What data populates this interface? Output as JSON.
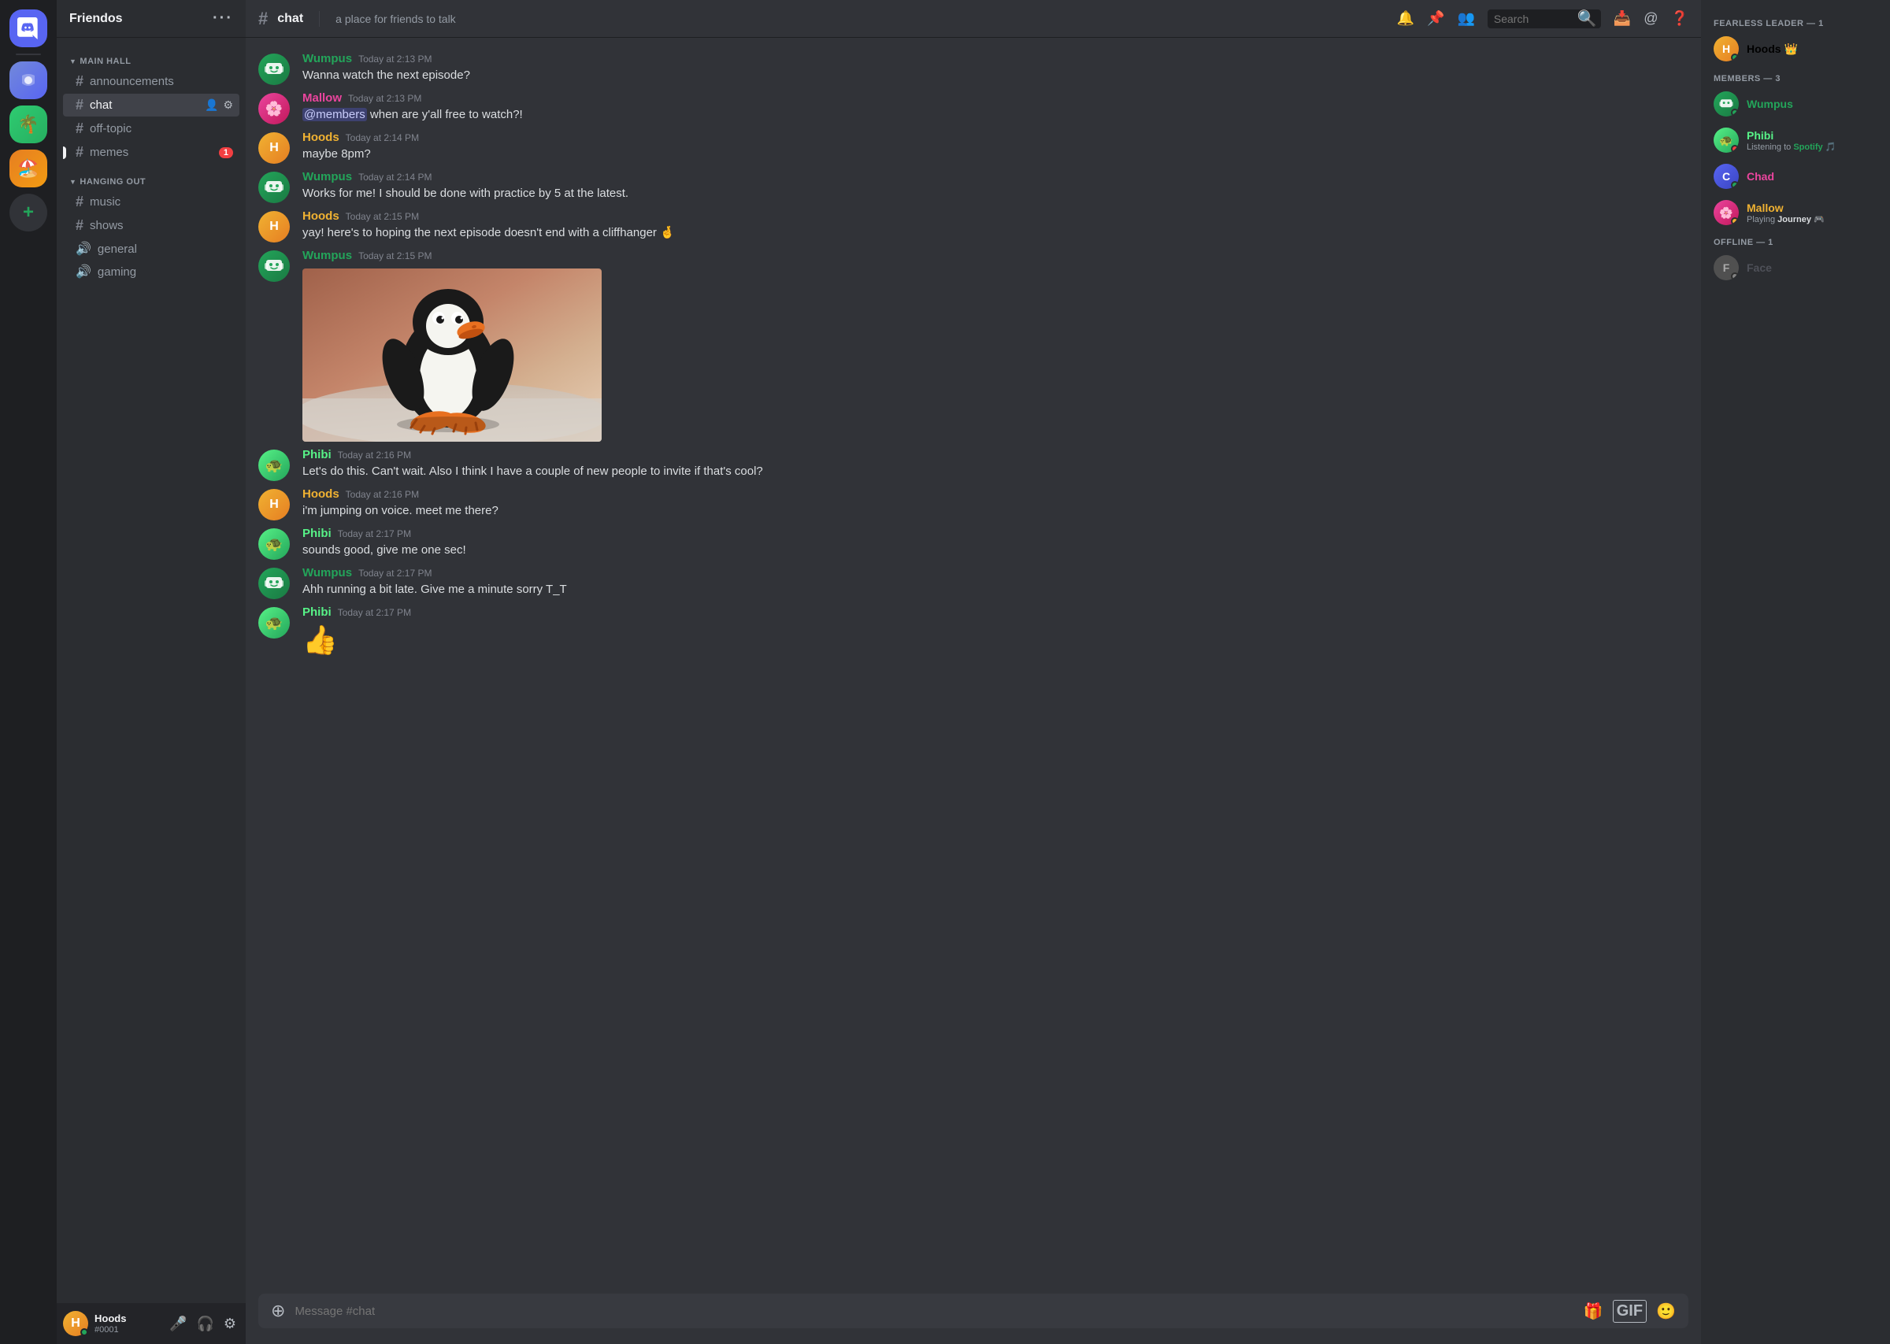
{
  "app": {
    "title": "Discord",
    "server_name": "Friendos",
    "more_options_label": "···"
  },
  "categories": [
    {
      "id": "main-hall",
      "label": "MAIN HALL",
      "channels": [
        {
          "id": "announcements",
          "type": "text",
          "name": "announcements",
          "active": false,
          "badge": null
        },
        {
          "id": "chat",
          "type": "text",
          "name": "chat",
          "active": true,
          "badge": null
        },
        {
          "id": "off-topic",
          "type": "text",
          "name": "off-topic",
          "active": false,
          "badge": null
        },
        {
          "id": "memes",
          "type": "text",
          "name": "memes",
          "active": false,
          "badge": 1
        }
      ]
    },
    {
      "id": "hanging-out",
      "label": "HANGING OUT",
      "channels": [
        {
          "id": "music",
          "type": "text",
          "name": "music",
          "active": false,
          "badge": null
        },
        {
          "id": "shows",
          "type": "text",
          "name": "shows",
          "active": false,
          "badge": null
        },
        {
          "id": "general",
          "type": "voice",
          "name": "general",
          "active": false,
          "badge": null
        },
        {
          "id": "gaming",
          "type": "voice",
          "name": "gaming",
          "active": false,
          "badge": null
        }
      ]
    }
  ],
  "channel": {
    "name": "chat",
    "topic": "a place for friends to talk"
  },
  "messages": [
    {
      "id": "msg1",
      "author": "Wumpus",
      "author_class": "wumpus",
      "timestamp": "Today at 2:13 PM",
      "text": "Wanna watch the next episode?",
      "continuation": false,
      "has_image": false
    },
    {
      "id": "msg2",
      "author": "Mallow",
      "author_class": "mallow",
      "timestamp": "Today at 2:13 PM",
      "text": "@members  when are y'all free to watch?!",
      "continuation": false,
      "has_image": false,
      "has_mention": true
    },
    {
      "id": "msg3",
      "author": "Hoods",
      "author_class": "hoods",
      "timestamp": "Today at 2:14 PM",
      "text": "maybe 8pm?",
      "continuation": false,
      "has_image": false
    },
    {
      "id": "msg4",
      "author": "Wumpus",
      "author_class": "wumpus",
      "timestamp": "Today at 2:14 PM",
      "text": "Works for me! I should be done with practice by 5 at the latest.",
      "continuation": false,
      "has_image": false
    },
    {
      "id": "msg5",
      "author": "Hoods",
      "author_class": "hoods",
      "timestamp": "Today at 2:15 PM",
      "text": "yay! here's to hoping the next episode doesn't end with a cliffhanger 🤞",
      "continuation": false,
      "has_image": false
    },
    {
      "id": "msg6",
      "author": "Wumpus",
      "author_class": "wumpus",
      "timestamp": "Today at 2:15 PM",
      "text": "",
      "continuation": false,
      "has_image": true
    },
    {
      "id": "msg7",
      "author": "Phibi",
      "author_class": "phibi",
      "timestamp": "Today at 2:16 PM",
      "text": "Let's do this. Can't wait. Also I think I have a couple of new people to invite if that's cool?",
      "continuation": false,
      "has_image": false
    },
    {
      "id": "msg8",
      "author": "Hoods",
      "author_class": "hoods",
      "timestamp": "Today at 2:16 PM",
      "text": "i'm jumping on voice. meet me there?",
      "continuation": false,
      "has_image": false
    },
    {
      "id": "msg9",
      "author": "Phibi",
      "author_class": "phibi",
      "timestamp": "Today at 2:17 PM",
      "text": "sounds good, give me one sec!",
      "continuation": false,
      "has_image": false
    },
    {
      "id": "msg10",
      "author": "Wumpus",
      "author_class": "wumpus",
      "timestamp": "Today at 2:17 PM",
      "text": "Ahh running a bit late. Give me a minute sorry T_T",
      "continuation": false,
      "has_image": false
    },
    {
      "id": "msg11",
      "author": "Phibi",
      "author_class": "phibi",
      "timestamp": "Today at 2:17 PM",
      "text": "👍",
      "continuation": false,
      "has_image": false,
      "is_emoji": true
    }
  ],
  "input": {
    "placeholder": "Message #chat"
  },
  "members": {
    "fearless_leader_count": 1,
    "members_count": 3,
    "offline_count": 1,
    "fearless_leaders": [
      {
        "name": "Hoods",
        "name_class": "hoods",
        "status": "online",
        "crown": true
      }
    ],
    "members": [
      {
        "name": "Wumpus",
        "name_class": "wumpus",
        "status": "online",
        "activity": null
      },
      {
        "name": "Phibi",
        "name_class": "phibi",
        "status": "dnd",
        "activity": "Listening to Spotify"
      },
      {
        "name": "Chad",
        "name_class": "chad",
        "status": "online",
        "activity": null
      },
      {
        "name": "Mallow",
        "name_class": "mallow",
        "status": "idle",
        "activity": "Playing Journey"
      }
    ],
    "offline": [
      {
        "name": "Face",
        "name_class": "face",
        "status": "offline",
        "activity": null
      }
    ]
  },
  "user": {
    "name": "Hoods",
    "discriminator": "#0001",
    "status": "online"
  },
  "labels": {
    "search_placeholder": "Search",
    "fearless_leader_label": "FEARLESS LEADER — 1",
    "members_label": "MEMBERS — 3",
    "offline_label": "OFFLINE — 1",
    "listening_to": "Listening to",
    "spotify": "Spotify",
    "playing": "Playing",
    "journey": "Journey"
  }
}
